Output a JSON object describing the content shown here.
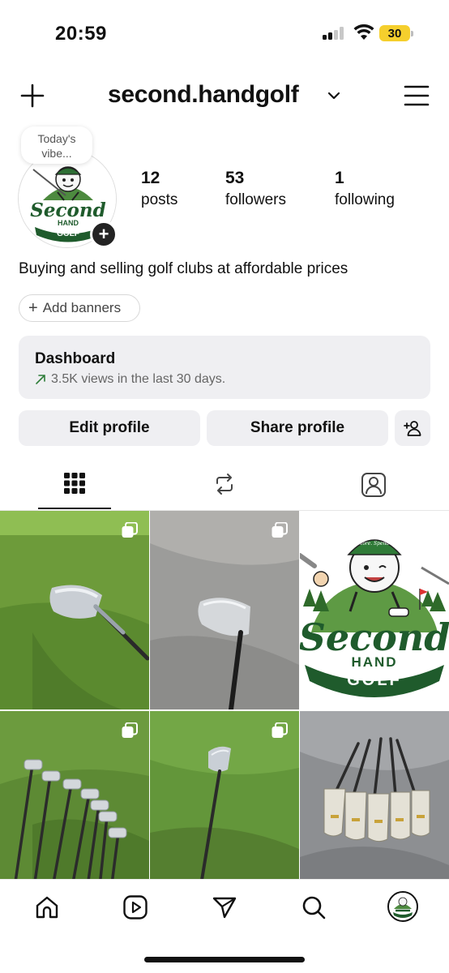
{
  "status_bar": {
    "time": "20:59",
    "battery": "30"
  },
  "header": {
    "username": "second.handgolf"
  },
  "profile": {
    "note": "Today's vibe...",
    "stats": [
      {
        "count": "12",
        "label": "posts"
      },
      {
        "count": "53",
        "label": "followers"
      },
      {
        "count": "1",
        "label": "following"
      }
    ],
    "bio": "Buying and selling golf clubs at affordable prices",
    "add_banners_label": "Add banners"
  },
  "dashboard": {
    "title": "Dashboard",
    "subtitle": "3.5K views in the last 30 days."
  },
  "actions": {
    "edit_label": "Edit profile",
    "share_label": "Share profile"
  },
  "logo": {
    "line1": "Second",
    "line2": "HAND",
    "line3": "GOLF",
    "cap_text": "Play More. Spend Less."
  },
  "grid": {
    "posts": [
      {
        "subject": "wedge on grass",
        "multi": true
      },
      {
        "subject": "iron on grey fabric",
        "multi": true
      },
      {
        "subject": "Second Hand Golf logo",
        "multi": false
      },
      {
        "subject": "iron set on grass",
        "multi": true
      },
      {
        "subject": "single iron on grass",
        "multi": true
      },
      {
        "subject": "iron set on grey background",
        "multi": false
      }
    ]
  },
  "icons": {
    "header": [
      "plus-icon",
      "chevron-down-icon",
      "menu-icon"
    ],
    "tabs": [
      "grid-icon",
      "reels-repost-icon",
      "tagged-icon"
    ],
    "nav": [
      "home-icon",
      "reels-icon",
      "send-icon",
      "search-icon",
      "profile-avatar"
    ]
  },
  "colors": {
    "logo_green": "#1f5b2c",
    "battery": "#f5cf2d",
    "button_bg": "#efeff2"
  }
}
